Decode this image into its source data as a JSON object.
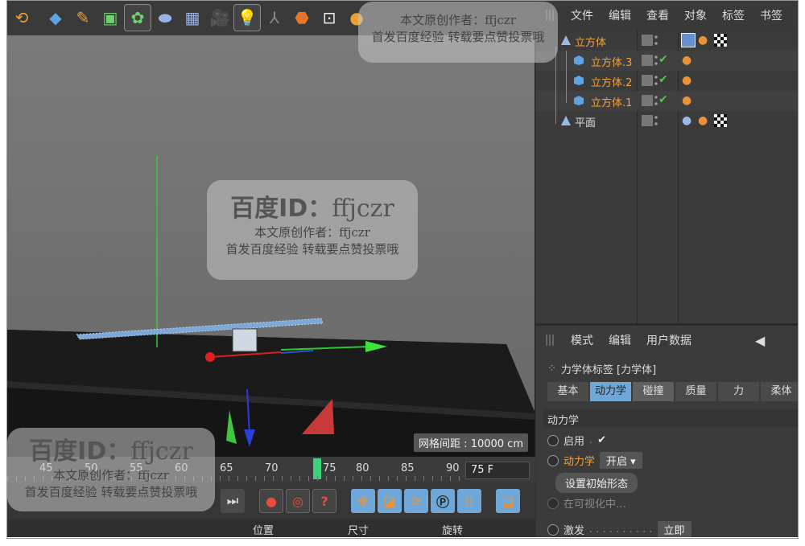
{
  "object_manager": {
    "menu": [
      "文件",
      "编辑",
      "查看",
      "对象",
      "标签",
      "书签"
    ],
    "objects": [
      {
        "name": "立方体",
        "color": "#f3a23a"
      },
      {
        "name": "立方体.3",
        "color": "#f3a23a"
      },
      {
        "name": "立方体.2",
        "color": "#f3a23a"
      },
      {
        "name": "立方体.1",
        "color": "#f3a23a"
      },
      {
        "name": "平面",
        "color": "#dddddd"
      }
    ]
  },
  "attribute_manager": {
    "menu": [
      "模式",
      "编辑",
      "用户数据"
    ],
    "title": "力学体标签 [力学体]",
    "tabs": [
      "基本",
      "动力学",
      "碰撞",
      "质量",
      "力",
      "柔体"
    ],
    "active_tab": "动力学",
    "section": "动力学",
    "enabled_label": "启用",
    "enabled_check": "✔",
    "dynamics_label": "动力学",
    "dynamics_value": "开启",
    "initial_button": "设置初始形态",
    "visualize_label": "在可视化中…",
    "trigger_label": "激发",
    "trigger_value": "立即"
  },
  "viewport": {
    "grid_readout": "网格间距 : 10000 cm"
  },
  "timeline": {
    "ticks": [
      "45",
      "50",
      "55",
      "60",
      "65",
      "70",
      "75",
      "80",
      "85",
      "90"
    ],
    "current_frame": 75,
    "frame_field": "75 F"
  },
  "coordinates": {
    "labels": [
      "位置",
      "尺寸",
      "旋转"
    ]
  },
  "watermark": {
    "big": "百度ID：",
    "id": "ffjczr",
    "line1": "本文原创作者：ffjczr",
    "line2": "首发百度经验  转载要点赞投票哦"
  },
  "icons": {
    "toolbar": [
      "undo-icon",
      "cube-icon",
      "pen-icon",
      "subdivide-icon",
      "array-icon",
      "deformer-icon",
      "floor-icon",
      "camera-icon",
      "light-icon",
      "axis-icon",
      "tag-icon",
      "render-icon",
      "coord-icon"
    ],
    "playback": [
      "goto-end-icon",
      "record-icon",
      "autokey-icon",
      "keyframe-help-icon",
      "move-icon",
      "scale-icon",
      "rotate-icon",
      "point-icon",
      "grid-icon",
      "film-icon"
    ]
  },
  "colors": {
    "accent_orange": "#f3a23a",
    "tab_active": "#6fa8d8",
    "timeline_marker": "#3dd17a"
  }
}
